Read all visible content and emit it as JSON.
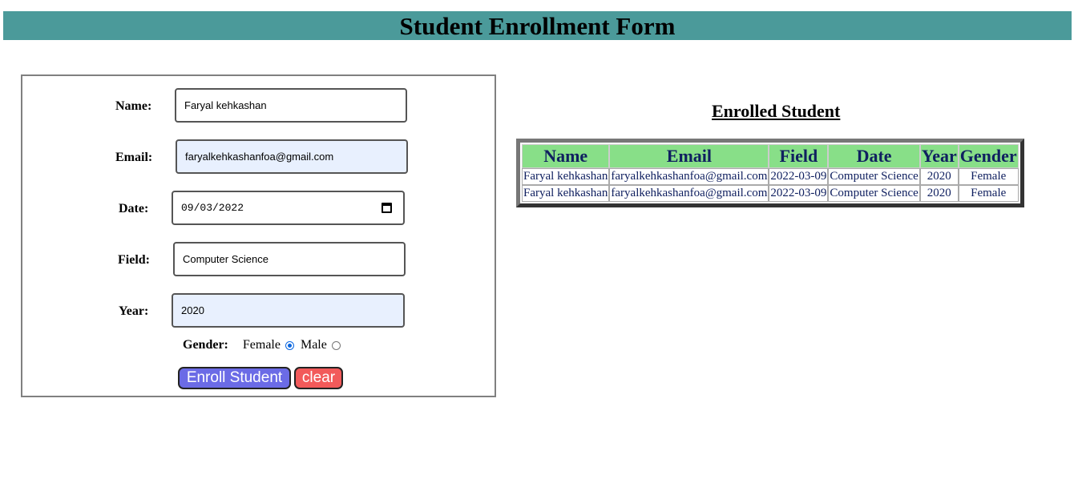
{
  "header": {
    "title": "Student Enrollment Form"
  },
  "form": {
    "name_label": "Name:",
    "name_value": "Faryal kehkashan",
    "email_label": "Email:",
    "email_value": "faryalkehkashanfoa@gmail.com",
    "date_label": "Date:",
    "date_value": "09/03/2022",
    "field_label": "Field:",
    "field_value": "Computer Science",
    "year_label": "Year:",
    "year_value": "2020",
    "gender_label": "Gender:",
    "gender_female": "Female",
    "gender_male": "Male",
    "gender_selected": "Female",
    "enroll_label": "Enroll Student",
    "clear_label": "clear",
    "enroll_color": "#6b6be6",
    "clear_color": "#f25a5a"
  },
  "enrolled": {
    "heading": "Enrolled Student",
    "columns": [
      "Name",
      "Email",
      "Field",
      "Date",
      "Year",
      "Gender"
    ],
    "rows": [
      [
        "Faryal kehkashan",
        "faryalkehkashanfoa@gmail.com",
        "2022-03-09",
        "Computer Science",
        "2020",
        "Female"
      ],
      [
        "Faryal kehkashan",
        "faryalkehkashanfoa@gmail.com",
        "2022-03-09",
        "Computer Science",
        "2020",
        "Female"
      ]
    ],
    "header_color": "#88df88"
  },
  "theme": {
    "title_bar": "#4b9a9a"
  }
}
